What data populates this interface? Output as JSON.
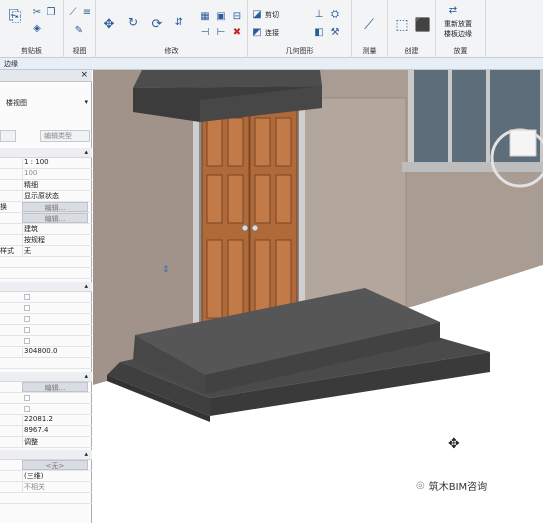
{
  "ribbon": {
    "groups": [
      "剪贴板",
      "视图",
      "修改",
      "几何图形",
      "测量",
      "创建",
      "放置"
    ],
    "geometry_items": [
      "剪切",
      "连接"
    ],
    "place_items": [
      "重新放置",
      "楼板边缘"
    ]
  },
  "context_bar": {
    "label": "边缘"
  },
  "properties": {
    "type_selector": "楼视图",
    "edit_type": "编辑类型",
    "rows": [
      {
        "key": "",
        "value": "1 : 100"
      },
      {
        "key": "",
        "value": "100"
      },
      {
        "key": "",
        "value": "精细"
      },
      {
        "key": "",
        "value": "显示原状态"
      },
      {
        "key": "换",
        "value": "编辑..."
      },
      {
        "key": "",
        "value": "编辑..."
      },
      {
        "key": "",
        "value": "建筑"
      },
      {
        "key": "",
        "value": "按规程"
      },
      {
        "key": "样式",
        "value": "无"
      }
    ],
    "section_rows": [
      {
        "value": "304800.0"
      },
      {
        "value": "编辑..."
      },
      {
        "value": "22081.2"
      },
      {
        "value": "8967.4"
      },
      {
        "value": "调整"
      },
      {
        "value": "<无>"
      },
      {
        "value": "(三维)"
      },
      {
        "value": "不相关"
      }
    ]
  },
  "watermark": {
    "text": "筑木BIM咨询"
  },
  "colors": {
    "ribbon_bg": "#f3f4f6",
    "wall": "#a99c93",
    "door": "#b06a3a",
    "slab": "#4a4a4a",
    "canopy": "#4d4d4d",
    "glass": "#5d6d79"
  }
}
